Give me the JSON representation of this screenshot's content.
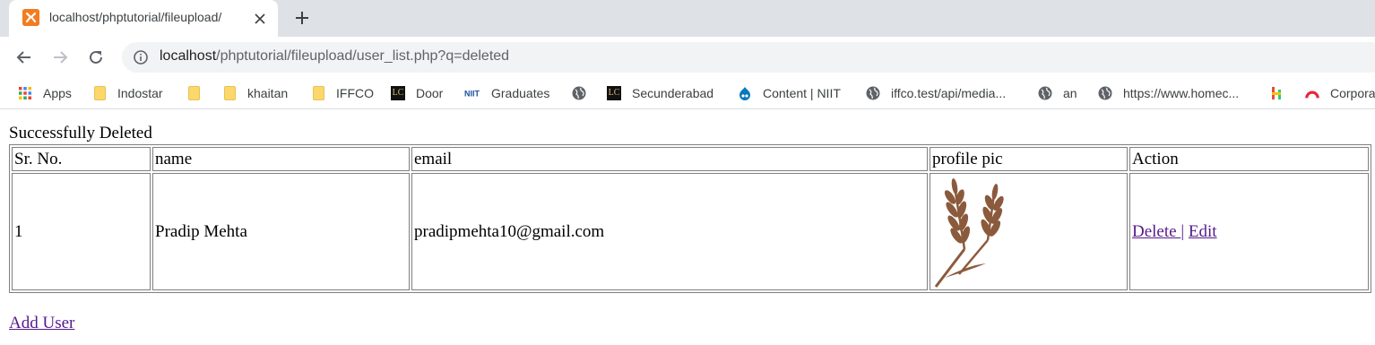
{
  "browser": {
    "tab": {
      "title": "localhost/phptutorial/fileupload/",
      "favicon": "xampp-icon"
    },
    "address": {
      "host": "localhost",
      "path": "/phptutorial/fileupload/user_list.php?q=deleted"
    },
    "bookmarks": [
      {
        "label": "Apps",
        "icon": "apps-grid-icon"
      },
      {
        "label": "Indostar",
        "icon": "folder-icon"
      },
      {
        "label": "",
        "icon": "folder-icon"
      },
      {
        "label": "khaitan",
        "icon": "folder-icon"
      },
      {
        "label": "IFFCO",
        "icon": "folder-icon"
      },
      {
        "label": "Door",
        "icon": "lc-icon"
      },
      {
        "label": "Graduates",
        "icon": "niit-icon"
      },
      {
        "label": "",
        "icon": "globe-icon"
      },
      {
        "label": "Secunderabad",
        "icon": "lc-icon"
      },
      {
        "label": "Content | NIIT",
        "icon": "drupal-icon"
      },
      {
        "label": "iffco.test/api/media...",
        "icon": "globe-icon"
      },
      {
        "label": "an",
        "icon": "globe-icon"
      },
      {
        "label": "https://www.homec...",
        "icon": "globe-icon"
      },
      {
        "label": "",
        "icon": "h-logo-icon"
      },
      {
        "label": "Corpora",
        "icon": "red-arc-icon"
      }
    ]
  },
  "page": {
    "message": "Successfully Deleted",
    "table": {
      "headers": [
        "Sr. No.",
        "name",
        "email",
        "profile pic",
        "Action"
      ],
      "rows": [
        {
          "sr_no": "1",
          "name": "Pradip Mehta",
          "email": "pradipmehta10@gmail.com",
          "profile_pic": "wheat-icon",
          "delete_label": "Delete ",
          "separator": "|",
          "edit_label": "Edit"
        }
      ]
    },
    "add_user_label": "Add User"
  },
  "colors": {
    "link": "#551a8b",
    "tabstrip": "#dee1e6",
    "wheat": "#8b5a3c"
  }
}
